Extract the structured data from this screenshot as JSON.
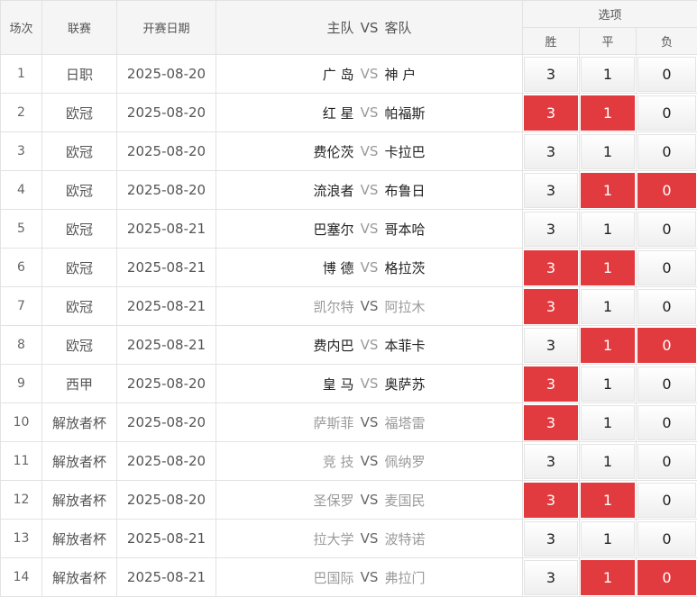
{
  "headers": {
    "round": "场次",
    "league": "联赛",
    "date": "开赛日期",
    "home": "主队",
    "vs": "VS",
    "away": "客队",
    "options": "选项",
    "win": "胜",
    "draw": "平",
    "lose": "负"
  },
  "colors": {
    "selected": "#e23b3f",
    "unselected": "#f3f3f3"
  },
  "rows": [
    {
      "no": "1",
      "league": "日职",
      "date": "2025-08-20",
      "home": "广 岛",
      "away": "神 户",
      "faded": false,
      "opts": [
        {
          "v": "3",
          "sel": false
        },
        {
          "v": "1",
          "sel": false
        },
        {
          "v": "0",
          "sel": false
        }
      ]
    },
    {
      "no": "2",
      "league": "欧冠",
      "date": "2025-08-20",
      "home": "红 星",
      "away": "帕福斯",
      "faded": false,
      "opts": [
        {
          "v": "3",
          "sel": true
        },
        {
          "v": "1",
          "sel": true
        },
        {
          "v": "0",
          "sel": false
        }
      ]
    },
    {
      "no": "3",
      "league": "欧冠",
      "date": "2025-08-20",
      "home": "费伦茨",
      "away": "卡拉巴",
      "faded": false,
      "opts": [
        {
          "v": "3",
          "sel": false
        },
        {
          "v": "1",
          "sel": false
        },
        {
          "v": "0",
          "sel": false
        }
      ]
    },
    {
      "no": "4",
      "league": "欧冠",
      "date": "2025-08-20",
      "home": "流浪者",
      "away": "布鲁日",
      "faded": false,
      "opts": [
        {
          "v": "3",
          "sel": false
        },
        {
          "v": "1",
          "sel": true
        },
        {
          "v": "0",
          "sel": true
        }
      ]
    },
    {
      "no": "5",
      "league": "欧冠",
      "date": "2025-08-21",
      "home": "巴塞尔",
      "away": "哥本哈",
      "faded": false,
      "opts": [
        {
          "v": "3",
          "sel": false
        },
        {
          "v": "1",
          "sel": false
        },
        {
          "v": "0",
          "sel": false
        }
      ]
    },
    {
      "no": "6",
      "league": "欧冠",
      "date": "2025-08-21",
      "home": "博 德",
      "away": "格拉茨",
      "faded": false,
      "opts": [
        {
          "v": "3",
          "sel": true
        },
        {
          "v": "1",
          "sel": true
        },
        {
          "v": "0",
          "sel": false
        }
      ]
    },
    {
      "no": "7",
      "league": "欧冠",
      "date": "2025-08-21",
      "home": "凯尔特",
      "away": "阿拉木",
      "faded": true,
      "opts": [
        {
          "v": "3",
          "sel": true
        },
        {
          "v": "1",
          "sel": false
        },
        {
          "v": "0",
          "sel": false
        }
      ]
    },
    {
      "no": "8",
      "league": "欧冠",
      "date": "2025-08-21",
      "home": "费内巴",
      "away": "本菲卡",
      "faded": false,
      "opts": [
        {
          "v": "3",
          "sel": false
        },
        {
          "v": "1",
          "sel": true
        },
        {
          "v": "0",
          "sel": true
        }
      ]
    },
    {
      "no": "9",
      "league": "西甲",
      "date": "2025-08-20",
      "home": "皇 马",
      "away": "奥萨苏",
      "faded": false,
      "opts": [
        {
          "v": "3",
          "sel": true
        },
        {
          "v": "1",
          "sel": false
        },
        {
          "v": "0",
          "sel": false
        }
      ]
    },
    {
      "no": "10",
      "league": "解放者杯",
      "date": "2025-08-20",
      "home": "萨斯菲",
      "away": "福塔雷",
      "faded": true,
      "opts": [
        {
          "v": "3",
          "sel": true
        },
        {
          "v": "1",
          "sel": false
        },
        {
          "v": "0",
          "sel": false
        }
      ]
    },
    {
      "no": "11",
      "league": "解放者杯",
      "date": "2025-08-20",
      "home": "竞 技",
      "away": "佩纳罗",
      "faded": true,
      "opts": [
        {
          "v": "3",
          "sel": false
        },
        {
          "v": "1",
          "sel": false
        },
        {
          "v": "0",
          "sel": false
        }
      ]
    },
    {
      "no": "12",
      "league": "解放者杯",
      "date": "2025-08-20",
      "home": "圣保罗",
      "away": "麦国民",
      "faded": true,
      "opts": [
        {
          "v": "3",
          "sel": true
        },
        {
          "v": "1",
          "sel": true
        },
        {
          "v": "0",
          "sel": false
        }
      ]
    },
    {
      "no": "13",
      "league": "解放者杯",
      "date": "2025-08-21",
      "home": "拉大学",
      "away": "波特诺",
      "faded": true,
      "opts": [
        {
          "v": "3",
          "sel": false
        },
        {
          "v": "1",
          "sel": false
        },
        {
          "v": "0",
          "sel": false
        }
      ]
    },
    {
      "no": "14",
      "league": "解放者杯",
      "date": "2025-08-21",
      "home": "巴国际",
      "away": "弗拉门",
      "faded": true,
      "opts": [
        {
          "v": "3",
          "sel": false
        },
        {
          "v": "1",
          "sel": true
        },
        {
          "v": "0",
          "sel": true
        }
      ]
    }
  ]
}
